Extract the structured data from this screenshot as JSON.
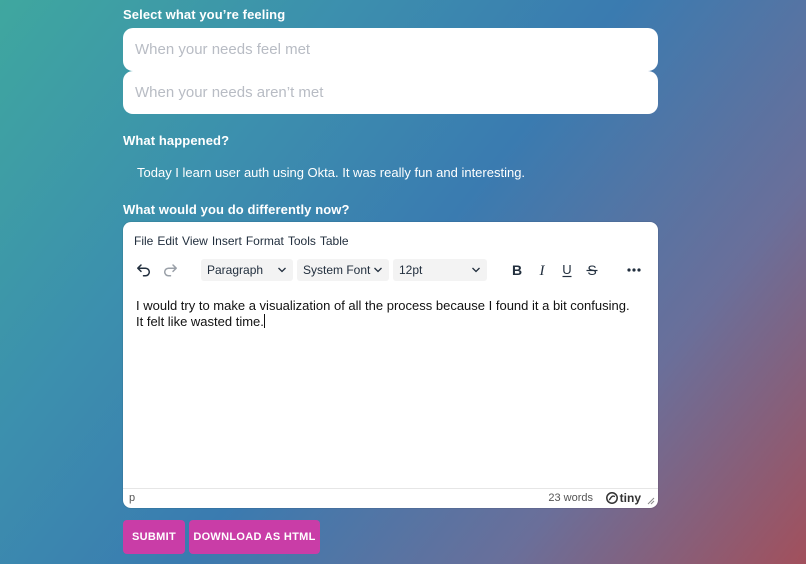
{
  "feelings": {
    "label": "Select what you’re feeling",
    "met_placeholder": "When your needs feel met",
    "unmet_placeholder": "When your needs aren’t met"
  },
  "happened": {
    "label": "What happened?",
    "text": "Today I learn user auth using Okta. It was really fun and interesting."
  },
  "differently": {
    "label": "What would you do differently now?"
  },
  "editor": {
    "menu": [
      "File",
      "Edit",
      "View",
      "Insert",
      "Format",
      "Tools",
      "Table"
    ],
    "block_format": "Paragraph",
    "font_family": "System Font",
    "font_size": "12pt",
    "content": "I would try to make a visualization of all the process because I found it a bit confusing. It felt like wasted time.",
    "status_path": "p",
    "word_count": "23 words",
    "brand": "tiny"
  },
  "actions": {
    "submit_label": "SUBMIT",
    "download_label": "DOWNLOAD AS HTML"
  },
  "colors": {
    "button_bg": "#c93da7",
    "gradient_start": "#3fa79f",
    "gradient_end": "#a2505c"
  }
}
